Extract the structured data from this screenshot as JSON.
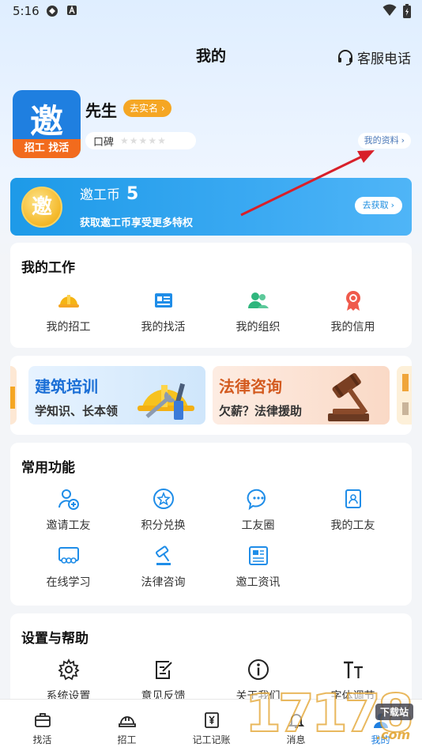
{
  "status_bar": {
    "time": "5:16"
  },
  "header": {
    "title": "我的",
    "service_label": "客服电话"
  },
  "profile": {
    "logo_char": "邀",
    "logo_strip": "招工 找活",
    "name": "先生",
    "realname_label": "去实名",
    "reputation_label": "口碑",
    "stars_filled": 0,
    "stars_total": 5,
    "profile_link": "我的资料"
  },
  "coin": {
    "icon_char": "邀",
    "title": "邀工币",
    "count": "5",
    "subtitle": "获取邀工币享受更多特权",
    "button": "去获取"
  },
  "my_work": {
    "title": "我的工作",
    "items": [
      {
        "label": "我的招工",
        "icon": "hardhat-icon"
      },
      {
        "label": "我的找活",
        "icon": "resume-card-icon"
      },
      {
        "label": "我的组织",
        "icon": "group-icon"
      },
      {
        "label": "我的信用",
        "icon": "credit-badge-icon"
      }
    ]
  },
  "banners": [
    {
      "title": "建筑培训",
      "subtitle": "学知识、长本领"
    },
    {
      "title": "法律咨询",
      "subtitle": "欠薪？法律援助"
    }
  ],
  "common": {
    "title": "常用功能",
    "items": [
      {
        "label": "邀请工友",
        "icon": "invite-user-icon"
      },
      {
        "label": "积分兑换",
        "icon": "star-exchange-icon"
      },
      {
        "label": "工友圈",
        "icon": "chat-bubble-icon"
      },
      {
        "label": "我的工友",
        "icon": "contact-book-icon"
      },
      {
        "label": "在线学习",
        "icon": "online-class-icon"
      },
      {
        "label": "法律咨询",
        "icon": "gavel-icon"
      },
      {
        "label": "邀工资讯",
        "icon": "news-icon"
      }
    ]
  },
  "settings": {
    "title": "设置与帮助",
    "items": [
      {
        "label": "系统设置",
        "icon": "gear-icon"
      },
      {
        "label": "意见反馈",
        "icon": "feedback-icon"
      },
      {
        "label": "关于我们",
        "icon": "info-icon"
      },
      {
        "label": "字体调节",
        "icon": "font-size-icon"
      }
    ]
  },
  "tabbar": {
    "items": [
      {
        "label": "找活",
        "icon": "briefcase-icon"
      },
      {
        "label": "招工",
        "icon": "hardhat-tab-icon"
      },
      {
        "label": "记工记账",
        "icon": "ledger-icon"
      },
      {
        "label": "消息",
        "icon": "bell-icon"
      },
      {
        "label": "我的",
        "icon": "person-icon"
      }
    ]
  },
  "watermark": {
    "digits": "17178",
    "tag": "下载站",
    "domain": ".com"
  },
  "colors": {
    "primary": "#1f7fe0",
    "accent": "#f5a623",
    "arrow": "#d8202a"
  }
}
